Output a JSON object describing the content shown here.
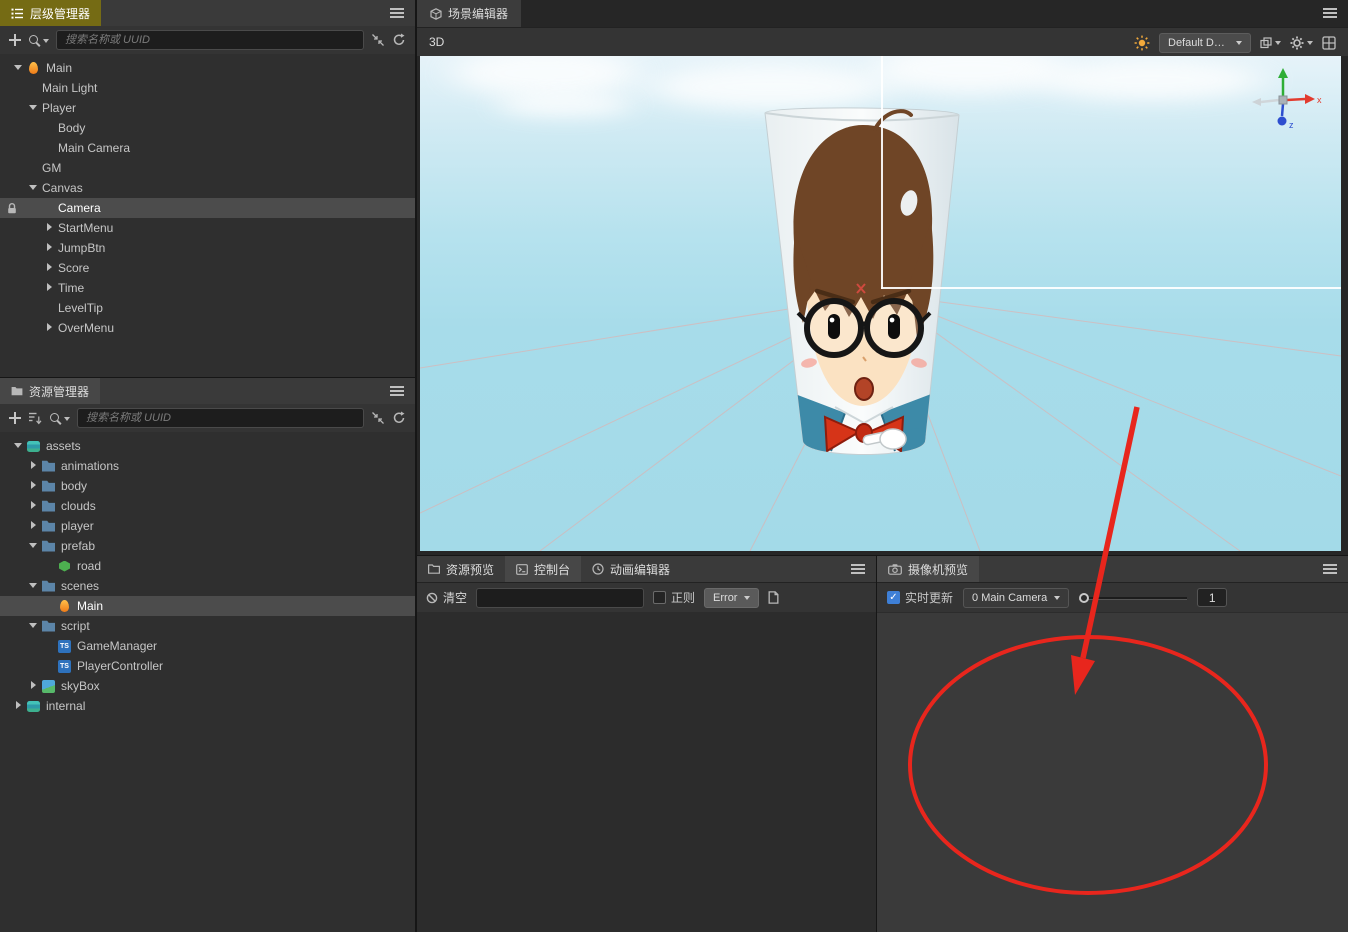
{
  "colors": {
    "annotation_red": "#e8261d",
    "accent_blue": "#3e7fd6",
    "focused_tab_yellow": "#756b14"
  },
  "hierarchy_panel": {
    "tab_label": "层级管理器",
    "search_placeholder": "搜索名称或 UUID",
    "items": [
      {
        "label": "Main",
        "level": 0,
        "icon": "scene",
        "expanded": true
      },
      {
        "label": "Main Light",
        "level": 1
      },
      {
        "label": "Player",
        "level": 1,
        "expanded": true
      },
      {
        "label": "Body",
        "level": 2
      },
      {
        "label": "Main Camera",
        "level": 2
      },
      {
        "label": "GM",
        "level": 1
      },
      {
        "label": "Canvas",
        "level": 1,
        "expanded": true
      },
      {
        "label": "Camera",
        "level": 2,
        "selected": true
      },
      {
        "label": "StartMenu",
        "level": 2,
        "collapsed": true
      },
      {
        "label": "JumpBtn",
        "level": 2,
        "collapsed": true
      },
      {
        "label": "Score",
        "level": 2,
        "collapsed": true
      },
      {
        "label": "Time",
        "level": 2,
        "collapsed": true
      },
      {
        "label": "LevelTip",
        "level": 2
      },
      {
        "label": "OverMenu",
        "level": 2,
        "collapsed": true
      }
    ]
  },
  "assets_panel": {
    "tab_label": "资源管理器",
    "search_placeholder": "搜索名称或 UUID",
    "items": [
      {
        "label": "assets",
        "level": 0,
        "icon": "db",
        "expanded": true
      },
      {
        "label": "animations",
        "level": 1,
        "icon": "folder",
        "collapsed": true
      },
      {
        "label": "body",
        "level": 1,
        "icon": "folder",
        "collapsed": true
      },
      {
        "label": "clouds",
        "level": 1,
        "icon": "folder",
        "collapsed": true
      },
      {
        "label": "player",
        "level": 1,
        "icon": "folder",
        "collapsed": true
      },
      {
        "label": "prefab",
        "level": 1,
        "icon": "folder",
        "expanded": true
      },
      {
        "label": "road",
        "level": 2,
        "icon": "prefab"
      },
      {
        "label": "scenes",
        "level": 1,
        "icon": "folder",
        "expanded": true
      },
      {
        "label": "Main",
        "level": 2,
        "icon": "scene",
        "selected": true
      },
      {
        "label": "script",
        "level": 1,
        "icon": "folder",
        "expanded": true
      },
      {
        "label": "GameManager",
        "level": 2,
        "icon": "ts"
      },
      {
        "label": "PlayerController",
        "level": 2,
        "icon": "ts"
      },
      {
        "label": "skyBox",
        "level": 1,
        "icon": "image",
        "collapsed": true
      },
      {
        "label": "internal",
        "level": 0,
        "icon": "db",
        "collapsed": true
      }
    ]
  },
  "scene_panel": {
    "tab_label": "场景编辑器",
    "mode_label": "3D",
    "device_dropdown": "Default De...",
    "axis_x": "x",
    "axis_z": "z"
  },
  "console_panel": {
    "tabs": [
      "资源预览",
      "控制台",
      "动画编辑器"
    ],
    "clear_label": "清空",
    "regex_label": "正则",
    "level_filter": "Error"
  },
  "camera_panel": {
    "tab_label": "摄像机预览",
    "realtime_label": "实时更新",
    "camera_select": "0 Main Camera",
    "value": "1"
  }
}
